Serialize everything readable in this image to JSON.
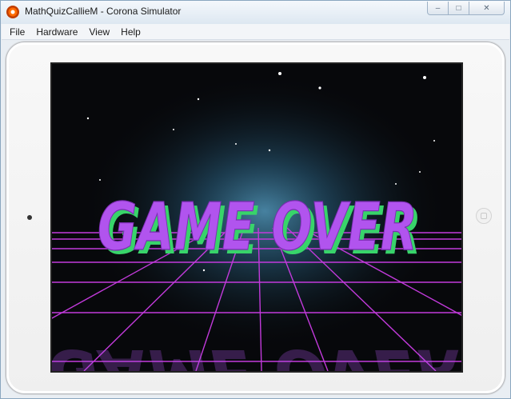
{
  "window": {
    "title": "MathQuizCallieM - Corona Simulator",
    "controls": {
      "minimize": "–",
      "maximize": "□",
      "close": "✕"
    }
  },
  "menu": {
    "items": [
      "File",
      "Hardware",
      "View",
      "Help"
    ]
  },
  "screen": {
    "game_over_text": "GAME OVER",
    "colors": {
      "text_fill": "#b154ee",
      "text_shadow": "#38d46a",
      "grid": "#c23adb",
      "glow": "#3c7090",
      "sky": "#07080b"
    }
  },
  "icons": {
    "app": "corona-app-icon",
    "camera": "camera-icon",
    "home": "home-button-icon"
  }
}
